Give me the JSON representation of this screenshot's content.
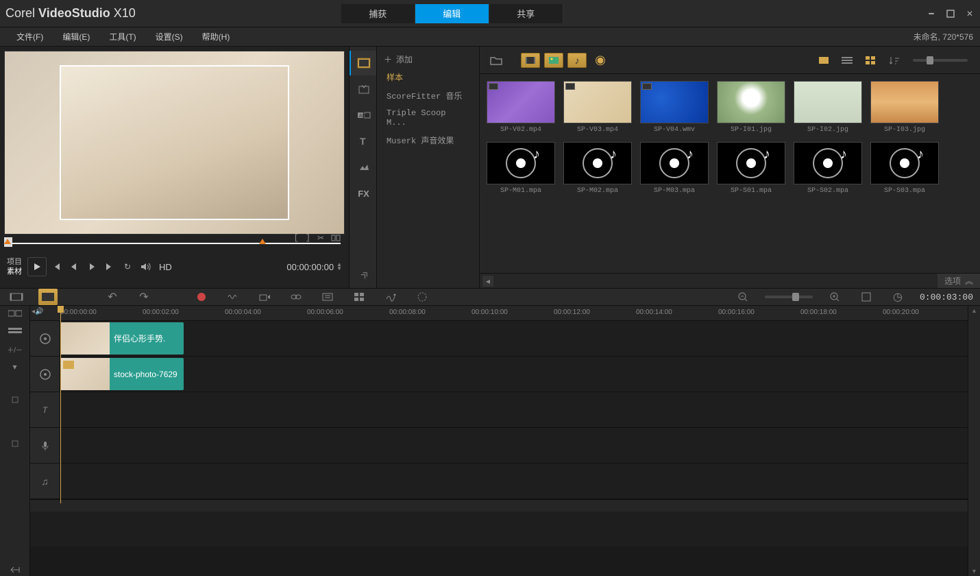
{
  "app": {
    "brand": "Corel",
    "name": "VideoStudio",
    "version": "X10"
  },
  "topTabs": [
    {
      "label": "捕获",
      "active": false
    },
    {
      "label": "编辑",
      "active": true
    },
    {
      "label": "共享",
      "active": false
    }
  ],
  "menu": {
    "items": [
      "文件(F)",
      "编辑(E)",
      "工具(T)",
      "设置(S)",
      "帮助(H)"
    ],
    "rightStatus": "未命名, 720*576"
  },
  "preview": {
    "labels": {
      "project": "项目",
      "clip": "素材"
    },
    "hd": "HD",
    "timecode": "00:00:00:00"
  },
  "library": {
    "addLabel": "添加",
    "categories": [
      {
        "label": "样本",
        "active": true
      },
      {
        "label": "ScoreFitter 音乐",
        "active": false
      },
      {
        "label": "Triple Scoop M...",
        "active": false
      },
      {
        "label": "Muserk 声音效果",
        "active": false
      }
    ],
    "browseLabel": "浏览",
    "items": [
      {
        "name": "SP-V02.mp4",
        "kind": "purple"
      },
      {
        "name": "SP-V03.mp4",
        "kind": "cream"
      },
      {
        "name": "SP-V04.wmv",
        "kind": "blue"
      },
      {
        "name": "SP-I01.jpg",
        "kind": "flower"
      },
      {
        "name": "SP-I02.jpg",
        "kind": "trees"
      },
      {
        "name": "SP-I03.jpg",
        "kind": "desert"
      },
      {
        "name": "SP-M01.mpa",
        "kind": "music"
      },
      {
        "name": "SP-M02.mpa",
        "kind": "music"
      },
      {
        "name": "SP-M03.mpa",
        "kind": "music"
      },
      {
        "name": "SP-S01.mpa",
        "kind": "music"
      },
      {
        "name": "SP-S02.mpa",
        "kind": "music"
      },
      {
        "name": "SP-S03.mpa",
        "kind": "music"
      }
    ],
    "optionsLabel": "选项"
  },
  "timeline": {
    "timecode": "0:00:03:00",
    "ruler": [
      "00:00:00:00",
      "00:00:02:00",
      "00:00:04:00",
      "00:00:06:00",
      "00:00:08:00",
      "00:00:10:00",
      "00:00:12:00",
      "00:00:14:00",
      "00:00:16:00",
      "00:00:18:00",
      "00:00:20:00"
    ],
    "clips": [
      {
        "label": "伴侣心形手势."
      },
      {
        "label": "stock-photo-7629"
      }
    ]
  }
}
